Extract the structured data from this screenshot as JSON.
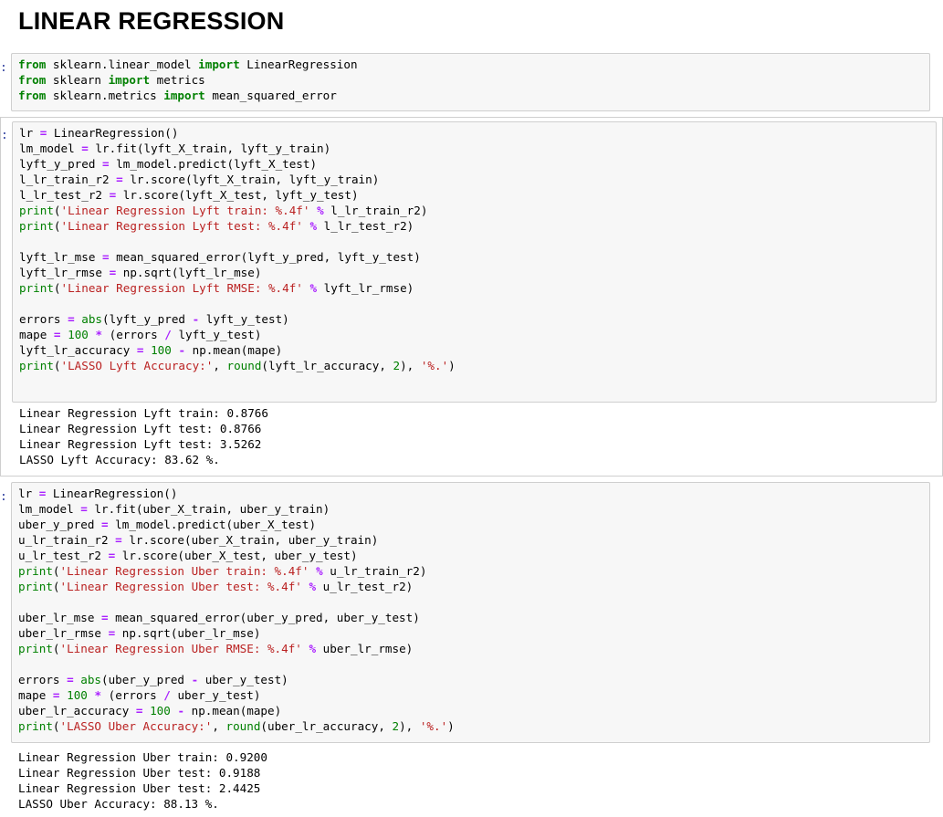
{
  "heading": "LINEAR REGRESSION",
  "cells": [
    {
      "prompt": ":",
      "code": [
        [
          [
            "kw",
            "from"
          ],
          [
            "t",
            " sklearn.linear_model "
          ],
          [
            "kw",
            "import"
          ],
          [
            "t",
            " LinearRegression"
          ]
        ],
        [
          [
            "kw",
            "from"
          ],
          [
            "t",
            " sklearn "
          ],
          [
            "kw",
            "import"
          ],
          [
            "t",
            " metrics"
          ]
        ],
        [
          [
            "kw",
            "from"
          ],
          [
            "t",
            " sklearn.metrics "
          ],
          [
            "kw",
            "import"
          ],
          [
            "t",
            " mean_squared_error"
          ]
        ]
      ],
      "output": []
    },
    {
      "prompt": ":",
      "code": [
        [
          [
            "t",
            "lr "
          ],
          [
            "op",
            "="
          ],
          [
            "t",
            " LinearRegression()"
          ]
        ],
        [
          [
            "t",
            "lm_model "
          ],
          [
            "op",
            "="
          ],
          [
            "t",
            " lr.fit(lyft_X_train, lyft_y_train)"
          ]
        ],
        [
          [
            "t",
            "lyft_y_pred "
          ],
          [
            "op",
            "="
          ],
          [
            "t",
            " lm_model.predict(lyft_X_test)"
          ]
        ],
        [
          [
            "t",
            "l_lr_train_r2 "
          ],
          [
            "op",
            "="
          ],
          [
            "t",
            " lr.score(lyft_X_train, lyft_y_train)"
          ]
        ],
        [
          [
            "t",
            "l_lr_test_r2 "
          ],
          [
            "op",
            "="
          ],
          [
            "t",
            " lr.score(lyft_X_test, lyft_y_test)"
          ]
        ],
        [
          [
            "bi",
            "print"
          ],
          [
            "t",
            "("
          ],
          [
            "str",
            "'Linear Regression Lyft train: %.4f'"
          ],
          [
            "t",
            " "
          ],
          [
            "op",
            "%"
          ],
          [
            "t",
            " l_lr_train_r2)"
          ]
        ],
        [
          [
            "bi",
            "print"
          ],
          [
            "t",
            "("
          ],
          [
            "str",
            "'Linear Regression Lyft test: %.4f'"
          ],
          [
            "t",
            " "
          ],
          [
            "op",
            "%"
          ],
          [
            "t",
            " l_lr_test_r2)"
          ]
        ],
        [],
        [
          [
            "t",
            "lyft_lr_mse "
          ],
          [
            "op",
            "="
          ],
          [
            "t",
            " mean_squared_error(lyft_y_pred, lyft_y_test)"
          ]
        ],
        [
          [
            "t",
            "lyft_lr_rmse "
          ],
          [
            "op",
            "="
          ],
          [
            "t",
            " np.sqrt(lyft_lr_mse)"
          ]
        ],
        [
          [
            "bi",
            "print"
          ],
          [
            "t",
            "("
          ],
          [
            "str",
            "'Linear Regression Lyft RMSE: %.4f'"
          ],
          [
            "t",
            " "
          ],
          [
            "op",
            "%"
          ],
          [
            "t",
            " lyft_lr_rmse)"
          ]
        ],
        [],
        [
          [
            "t",
            "errors "
          ],
          [
            "op",
            "="
          ],
          [
            "t",
            " "
          ],
          [
            "bi",
            "abs"
          ],
          [
            "t",
            "(lyft_y_pred "
          ],
          [
            "op",
            "-"
          ],
          [
            "t",
            " lyft_y_test)"
          ]
        ],
        [
          [
            "t",
            "mape "
          ],
          [
            "op",
            "="
          ],
          [
            "t",
            " "
          ],
          [
            "num",
            "100"
          ],
          [
            "t",
            " "
          ],
          [
            "op",
            "*"
          ],
          [
            "t",
            " (errors "
          ],
          [
            "op",
            "/"
          ],
          [
            "t",
            " lyft_y_test)"
          ]
        ],
        [
          [
            "t",
            "lyft_lr_accuracy "
          ],
          [
            "op",
            "="
          ],
          [
            "t",
            " "
          ],
          [
            "num",
            "100"
          ],
          [
            "t",
            " "
          ],
          [
            "op",
            "-"
          ],
          [
            "t",
            " np.mean(mape)"
          ]
        ],
        [
          [
            "bi",
            "print"
          ],
          [
            "t",
            "("
          ],
          [
            "str",
            "'LASSO Lyft Accuracy:'"
          ],
          [
            "t",
            ", "
          ],
          [
            "bi",
            "round"
          ],
          [
            "t",
            "(lyft_lr_accuracy, "
          ],
          [
            "num",
            "2"
          ],
          [
            "t",
            "), "
          ],
          [
            "str",
            "'%.'"
          ],
          [
            "t",
            ")"
          ]
        ]
      ],
      "output": [
        "Linear Regression Lyft train: 0.8766",
        "Linear Regression Lyft test: 0.8766",
        "Linear Regression Lyft test: 3.5262",
        "LASSO Lyft Accuracy: 83.62 %."
      ]
    },
    {
      "prompt": ":",
      "code": [
        [
          [
            "t",
            "lr "
          ],
          [
            "op",
            "="
          ],
          [
            "t",
            " LinearRegression()"
          ]
        ],
        [
          [
            "t",
            "lm_model "
          ],
          [
            "op",
            "="
          ],
          [
            "t",
            " lr.fit(uber_X_train, uber_y_train)"
          ]
        ],
        [
          [
            "t",
            "uber_y_pred "
          ],
          [
            "op",
            "="
          ],
          [
            "t",
            " lm_model.predict(uber_X_test)"
          ]
        ],
        [
          [
            "t",
            "u_lr_train_r2 "
          ],
          [
            "op",
            "="
          ],
          [
            "t",
            " lr.score(uber_X_train, uber_y_train)"
          ]
        ],
        [
          [
            "t",
            "u_lr_test_r2 "
          ],
          [
            "op",
            "="
          ],
          [
            "t",
            " lr.score(uber_X_test, uber_y_test)"
          ]
        ],
        [
          [
            "bi",
            "print"
          ],
          [
            "t",
            "("
          ],
          [
            "str",
            "'Linear Regression Uber train: %.4f'"
          ],
          [
            "t",
            " "
          ],
          [
            "op",
            "%"
          ],
          [
            "t",
            " u_lr_train_r2)"
          ]
        ],
        [
          [
            "bi",
            "print"
          ],
          [
            "t",
            "("
          ],
          [
            "str",
            "'Linear Regression Uber test: %.4f'"
          ],
          [
            "t",
            " "
          ],
          [
            "op",
            "%"
          ],
          [
            "t",
            " u_lr_test_r2)"
          ]
        ],
        [],
        [
          [
            "t",
            "uber_lr_mse "
          ],
          [
            "op",
            "="
          ],
          [
            "t",
            " mean_squared_error(uber_y_pred, uber_y_test)"
          ]
        ],
        [
          [
            "t",
            "uber_lr_rmse "
          ],
          [
            "op",
            "="
          ],
          [
            "t",
            " np.sqrt(uber_lr_mse)"
          ]
        ],
        [
          [
            "bi",
            "print"
          ],
          [
            "t",
            "("
          ],
          [
            "str",
            "'Linear Regression Uber RMSE: %.4f'"
          ],
          [
            "t",
            " "
          ],
          [
            "op",
            "%"
          ],
          [
            "t",
            " uber_lr_rmse)"
          ]
        ],
        [],
        [
          [
            "t",
            "errors "
          ],
          [
            "op",
            "="
          ],
          [
            "t",
            " "
          ],
          [
            "bi",
            "abs"
          ],
          [
            "t",
            "(uber_y_pred "
          ],
          [
            "op",
            "-"
          ],
          [
            "t",
            " uber_y_test)"
          ]
        ],
        [
          [
            "t",
            "mape "
          ],
          [
            "op",
            "="
          ],
          [
            "t",
            " "
          ],
          [
            "num",
            "100"
          ],
          [
            "t",
            " "
          ],
          [
            "op",
            "*"
          ],
          [
            "t",
            " (errors "
          ],
          [
            "op",
            "/"
          ],
          [
            "t",
            " uber_y_test)"
          ]
        ],
        [
          [
            "t",
            "uber_lr_accuracy "
          ],
          [
            "op",
            "="
          ],
          [
            "t",
            " "
          ],
          [
            "num",
            "100"
          ],
          [
            "t",
            " "
          ],
          [
            "op",
            "-"
          ],
          [
            "t",
            " np.mean(mape)"
          ]
        ],
        [
          [
            "bi",
            "print"
          ],
          [
            "t",
            "("
          ],
          [
            "str",
            "'LASSO Uber Accuracy:'"
          ],
          [
            "t",
            ", "
          ],
          [
            "bi",
            "round"
          ],
          [
            "t",
            "(uber_lr_accuracy, "
          ],
          [
            "num",
            "2"
          ],
          [
            "t",
            "), "
          ],
          [
            "str",
            "'%.'"
          ],
          [
            "t",
            ")"
          ]
        ]
      ],
      "output": [
        "Linear Regression Uber train: 0.9200",
        "Linear Regression Uber test: 0.9188",
        "Linear Regression Uber test: 2.4425",
        "LASSO Uber Accuracy: 88.13 %."
      ]
    }
  ]
}
